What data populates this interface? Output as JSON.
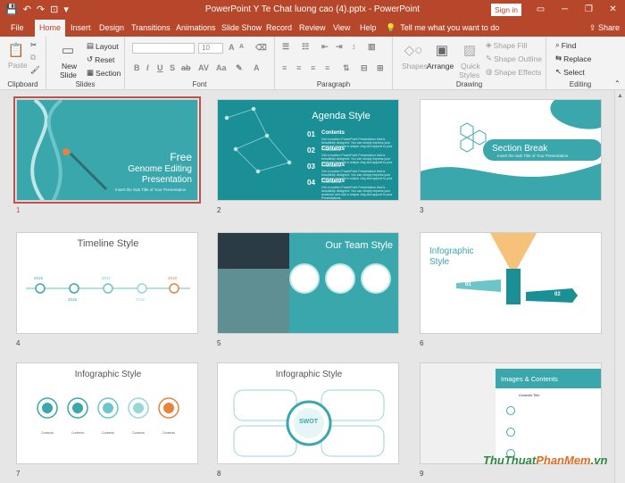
{
  "window": {
    "title": "PowerPoint Y Te Chat luong cao (4).pptx - PowerPoint",
    "signin": "Sign in",
    "share": "Share"
  },
  "qat": {
    "save": "💾",
    "undo": "↶",
    "redo": "↷",
    "present": "⊡",
    "more": "▾"
  },
  "window_buttons": {
    "options": "▭",
    "minimize": "─",
    "restore": "❐",
    "close": "✕"
  },
  "tabs": [
    "File",
    "Home",
    "Insert",
    "Design",
    "Transitions",
    "Animations",
    "Slide Show",
    "Record",
    "Review",
    "View",
    "Help"
  ],
  "active_tab": "Home",
  "tellme": {
    "icon": "💡",
    "text": "Tell me what you want to do"
  },
  "ribbon": {
    "clipboard": {
      "label": "Clipboard",
      "paste": "Paste"
    },
    "slides": {
      "label": "Slides",
      "new_slide_1": "New",
      "new_slide_2": "Slide",
      "layout": "Layout",
      "reset": "Reset",
      "section": "Section"
    },
    "font": {
      "label": "Font",
      "size": "10"
    },
    "paragraph": {
      "label": "Paragraph"
    },
    "drawing": {
      "label": "Drawing",
      "shapes": "Shapes",
      "arrange": "Arrange",
      "quick_styles_1": "Quick",
      "quick_styles_2": "Styles",
      "shape_fill": "Shape Fill",
      "shape_outline": "Shape Outline",
      "shape_effects": "Shape Effects"
    },
    "editing": {
      "label": "Editing",
      "find": "Find",
      "replace": "Replace",
      "select": "Select"
    }
  },
  "slides": [
    {
      "num": "1",
      "title_1": "Free",
      "title_2": "Genome Editing",
      "title_3": "Presentation",
      "subtitle": "Insert the Sub Title of Your Presentation"
    },
    {
      "num": "2",
      "title": "Agenda Style",
      "items": [
        {
          "num": "01",
          "heading": "Contents",
          "text": "Get a modern PowerPoint Presentation that is beautifully designed. You can simply impress your audience and add a unique zing and appeal to your Presentations."
        },
        {
          "num": "02",
          "heading": "Contents",
          "text": "Get a modern PowerPoint Presentation that is beautifully designed. You can simply impress your audience and add a unique zing and appeal to your Presentations."
        },
        {
          "num": "03",
          "heading": "Contents",
          "text": "Get a modern PowerPoint Presentation that is beautifully designed. You can simply impress your audience and add a unique zing and appeal to your Presentations."
        },
        {
          "num": "04",
          "heading": "Contents",
          "text": "Get a modern PowerPoint Presentation that is beautifully designed. You can simply impress your audience and add a unique zing and appeal to your Presentations."
        }
      ]
    },
    {
      "num": "3",
      "title": "Section Break",
      "subtitle": "Insert the Sub Title of Your Presentation"
    },
    {
      "num": "4",
      "title": "Timeline Style",
      "years": [
        "2015",
        "2016",
        "2017",
        "2018",
        "2019"
      ]
    },
    {
      "num": "5",
      "title": "Our Team Style"
    },
    {
      "num": "6",
      "title_1": "Infographic",
      "title_2": "Style",
      "num1": "01",
      "num2": "02"
    },
    {
      "num": "7",
      "title": "Infographic Style",
      "label": "Contents"
    },
    {
      "num": "8",
      "title": "Infographic Style",
      "center": "SWOT"
    },
    {
      "num": "9",
      "title": "Images & Contents",
      "label": "Contents Title"
    }
  ],
  "watermark": {
    "part1": "ThuThuat",
    "part2": "PhanMem",
    "part3": ".vn"
  },
  "colors": {
    "accent": "#b7472a",
    "teal": "#3aa7ac",
    "selection": "#c0504d"
  }
}
